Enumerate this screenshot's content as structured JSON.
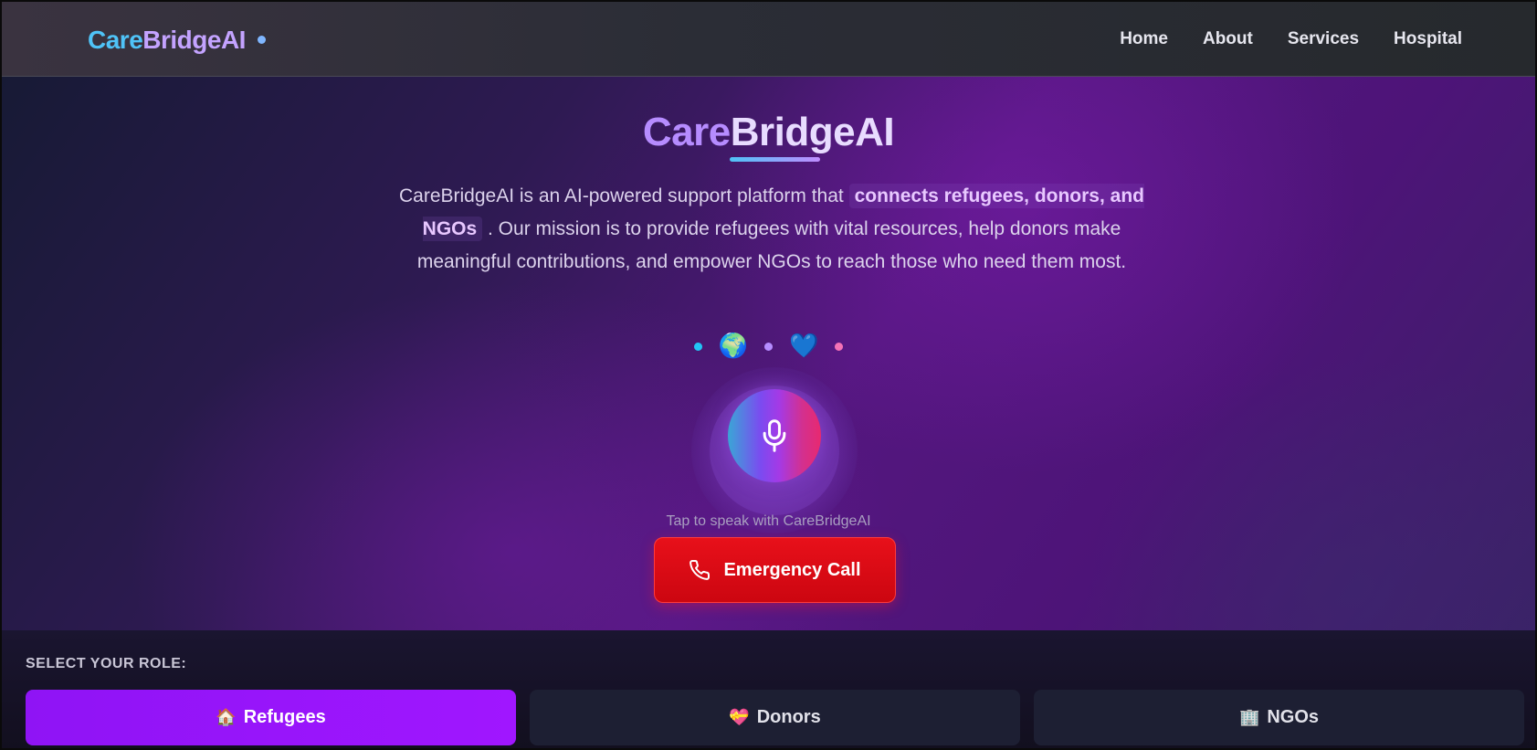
{
  "brand": {
    "logo_care": "Care",
    "logo_bridge": "BridgeAI",
    "accent_blue": "#4fc3f7",
    "accent_purple": "#c4a3ff"
  },
  "nav": {
    "links": [
      {
        "label": "Home"
      },
      {
        "label": "About"
      },
      {
        "label": "Services"
      },
      {
        "label": "Hospital"
      }
    ]
  },
  "hero": {
    "title_care": "Care",
    "title_bridge": "BridgeAI",
    "desc_before": "CareBridgeAI is an AI-powered support platform that",
    "desc_highlight": "connects refugees, donors, and NGOs",
    "desc_after": ". Our mission is to provide refugees with vital resources, help donors make meaningful contributions, and empower NGOs to reach those who need them most.",
    "emojis": [
      {
        "icon": "globe-icon",
        "glyph": "🌍"
      },
      {
        "icon": "heart-icon",
        "glyph": "💙"
      }
    ],
    "mic_caption": "Tap to speak with CareBridgeAI",
    "emergency_label": "Emergency Call",
    "emergency_color": "#e0101a"
  },
  "roles": {
    "label": "SELECT YOUR ROLE:",
    "items": [
      {
        "label": "Refugees",
        "glyph": "🏠",
        "icon": "house-icon",
        "active": true
      },
      {
        "label": "Donors",
        "glyph": "💝",
        "icon": "gift-heart-icon",
        "active": false
      },
      {
        "label": "NGOs",
        "glyph": "🏢",
        "icon": "building-icon",
        "active": false
      }
    ],
    "active_color": "#9614fa"
  }
}
